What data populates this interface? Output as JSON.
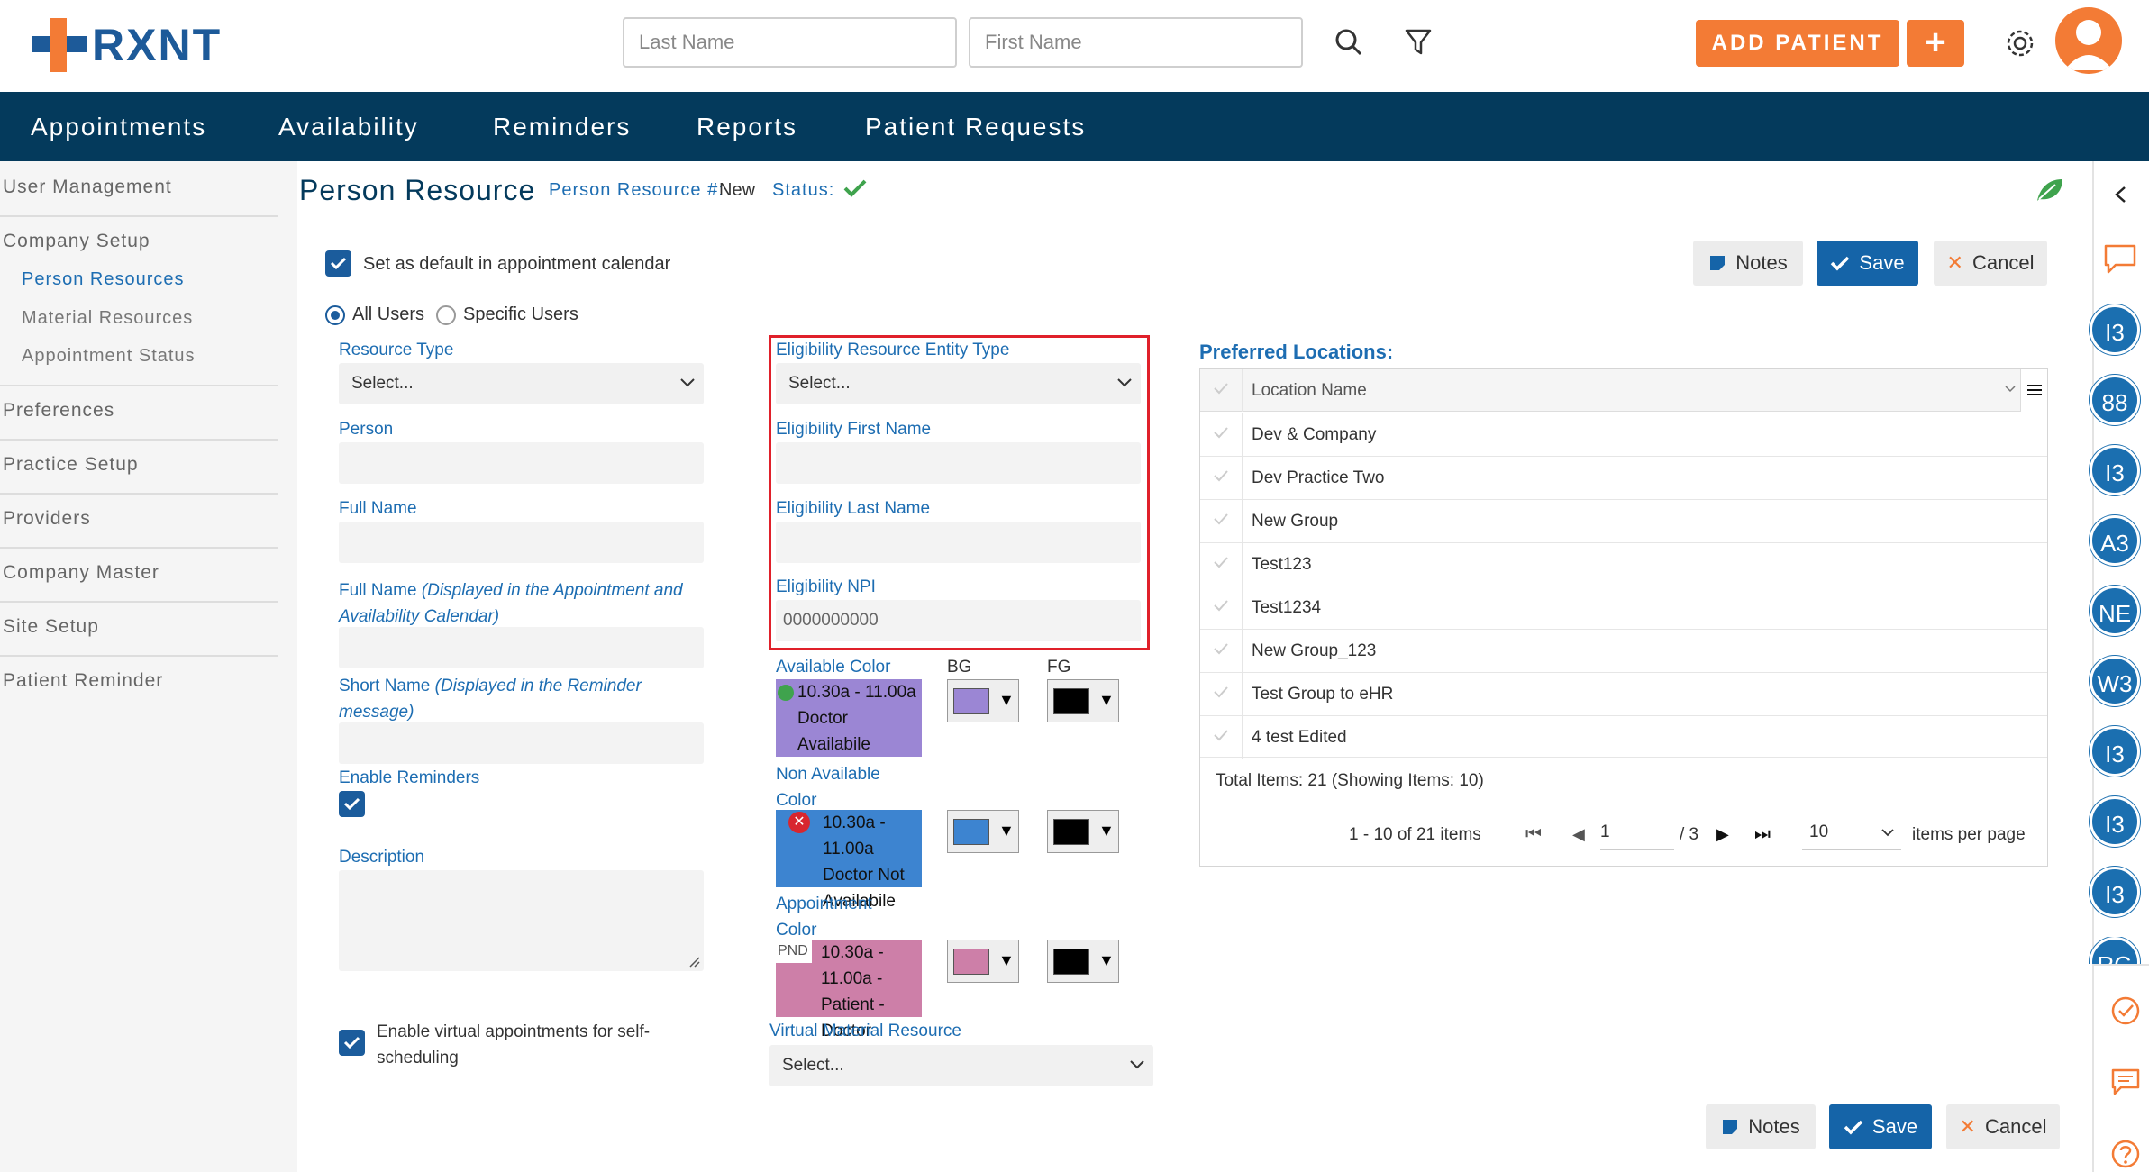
{
  "app": {
    "logo_text": "RXNT"
  },
  "header": {
    "last_name_placeholder": "Last Name",
    "first_name_placeholder": "First Name",
    "add_patient_label": "ADD PATIENT",
    "plus_label": "+"
  },
  "nav": {
    "items": [
      "Appointments",
      "Availability",
      "Reminders",
      "Reports",
      "Patient Requests"
    ]
  },
  "sidebar": {
    "items": [
      "User Management",
      "Company Setup",
      "Person Resources",
      "Material Resources",
      "Appointment Status",
      "Preferences",
      "Practice Setup",
      "Providers",
      "Company Master",
      "Site Setup",
      "Patient Reminder"
    ]
  },
  "page": {
    "title": "Person Resource",
    "number_label": "Person Resource #:",
    "number_value": "New",
    "status_label": "Status:"
  },
  "form": {
    "default_calendar_label": "Set as default in appointment calendar",
    "all_users": "All Users",
    "specific_users": "Specific Users",
    "resource_type_label": "Resource Type",
    "resource_type_value": "Select...",
    "person_label": "Person",
    "full_name_label": "Full Name",
    "full_name_display_label": "Full Name",
    "full_name_display_note": "(Displayed in the Appointment and Availability Calendar)",
    "short_name_label": "Short Name",
    "short_name_note": "(Displayed in the Reminder message)",
    "enable_reminders_label": "Enable Reminders",
    "description_label": "Description",
    "virtual_label": "Enable virtual appointments for self-scheduling",
    "elig_type_label": "Eligibility Resource Entity Type",
    "elig_type_value": "Select...",
    "elig_first_label": "Eligibility First Name",
    "elig_last_label": "Eligibility Last Name",
    "elig_npi_label": "Eligibility NPI",
    "elig_npi_placeholder": "0000000000",
    "available_color_label": "Available Color",
    "bg_label": "BG",
    "fg_label": "FG",
    "available_sample": "10.30a - 11.00a Doctor Availabile",
    "non_available_label": "Non Available Color",
    "non_available_sample": "10.30a - 11.00a Doctor Not Availabile",
    "appointment_color_label": "Appointment Color",
    "appointment_prefix": "PND",
    "appointment_sample": "10.30a - 11.00a - Patient - Doctor",
    "virtual_material_label": "Virtual Material Resource",
    "virtual_material_value": "Select..."
  },
  "colors": {
    "available_bg": "#9b86d4",
    "non_available_bg": "#3d84d0",
    "appointment_bg": "#cd7fa8",
    "fg": "#000000",
    "accent": "#f37b35",
    "nav": "#043a5c"
  },
  "actions": {
    "notes": "Notes",
    "save": "Save",
    "cancel": "Cancel"
  },
  "locations": {
    "title": "Preferred Locations:",
    "column": "Location Name",
    "rows": [
      "Dev & Company",
      "Dev Practice Two",
      "New Group",
      "Test123",
      "Test1234",
      "New Group_123",
      "Test Group to eHR",
      "4 test Edited"
    ],
    "total": "Total Items: 21 (Showing Items: 10)",
    "range": "1 - 10 of 21 items",
    "page": "1",
    "pages": "/ 3",
    "page_size": "10",
    "per_page": "items per page"
  },
  "rail": {
    "avatars": [
      "I3",
      "88",
      "I3",
      "A3",
      "NE",
      "W3",
      "I3",
      "I3",
      "I3",
      "RG"
    ]
  }
}
